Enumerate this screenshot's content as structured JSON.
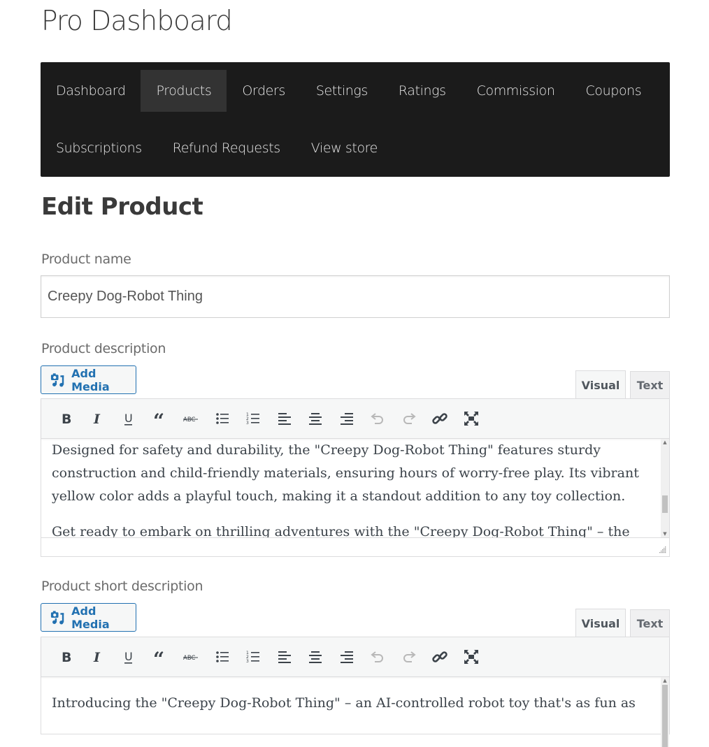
{
  "header": {
    "title": "Pro Dashboard"
  },
  "nav": {
    "row1": [
      {
        "label": "Dashboard",
        "active": false
      },
      {
        "label": "Products",
        "active": true
      },
      {
        "label": "Orders",
        "active": false
      },
      {
        "label": "Settings",
        "active": false
      },
      {
        "label": "Ratings",
        "active": false
      },
      {
        "label": "Commission",
        "active": false
      },
      {
        "label": "Coupons",
        "active": false
      }
    ],
    "row2": [
      {
        "label": "Subscriptions",
        "active": false
      },
      {
        "label": "Refund Requests",
        "active": false
      },
      {
        "label": "View store",
        "active": false
      }
    ]
  },
  "section": {
    "title": "Edit Product"
  },
  "product_name": {
    "label": "Product name",
    "value": "Creepy Dog-Robot Thing"
  },
  "description": {
    "label": "Product description",
    "add_media_label": "Add Media",
    "tab_visual": "Visual",
    "tab_text": "Text",
    "active_tab": "Visual",
    "paragraphs": [
      "Designed for safety and durability, the \"Creepy Dog-Robot Thing\" features sturdy construction and child-friendly materials, ensuring hours of worry-free play. Its vibrant yellow color adds a playful touch, making it a standout addition to any toy collection.",
      "Get ready to embark on thrilling adventures with the \"Creepy Dog-Robot Thing\" – the"
    ],
    "scroll_position": 0.78
  },
  "short_description": {
    "label": "Product short description",
    "add_media_label": "Add Media",
    "tab_visual": "Visual",
    "tab_text": "Text",
    "active_tab": "Visual",
    "paragraphs": [
      "Introducing the \"Creepy Dog-Robot Thing\" – an AI-controlled robot toy that's as fun as"
    ],
    "scroll_position": 0.0
  },
  "toolbar": {
    "buttons": [
      {
        "name": "bold",
        "icon": "bold-icon",
        "enabled": true
      },
      {
        "name": "italic",
        "icon": "italic-icon",
        "enabled": true
      },
      {
        "name": "underline",
        "icon": "underline-icon",
        "enabled": true
      },
      {
        "name": "blockquote",
        "icon": "blockquote-icon",
        "enabled": true
      },
      {
        "name": "strikethrough",
        "icon": "strikethrough-icon",
        "enabled": true
      },
      {
        "name": "bullet-list",
        "icon": "bullet-list-icon",
        "enabled": true
      },
      {
        "name": "numbered-list",
        "icon": "numbered-list-icon",
        "enabled": true
      },
      {
        "name": "align-left",
        "icon": "align-left-icon",
        "enabled": true
      },
      {
        "name": "align-center",
        "icon": "align-center-icon",
        "enabled": true
      },
      {
        "name": "align-right",
        "icon": "align-right-icon",
        "enabled": true
      },
      {
        "name": "undo",
        "icon": "undo-icon",
        "enabled": false
      },
      {
        "name": "redo",
        "icon": "redo-icon",
        "enabled": false
      },
      {
        "name": "link",
        "icon": "link-icon",
        "enabled": true
      },
      {
        "name": "fullscreen",
        "icon": "fullscreen-icon",
        "enabled": true
      }
    ],
    "strike_glyph": "ABC"
  },
  "colors": {
    "nav_bg": "#1b1b1b",
    "nav_active_bg": "#333333",
    "accent": "#2271b1"
  }
}
